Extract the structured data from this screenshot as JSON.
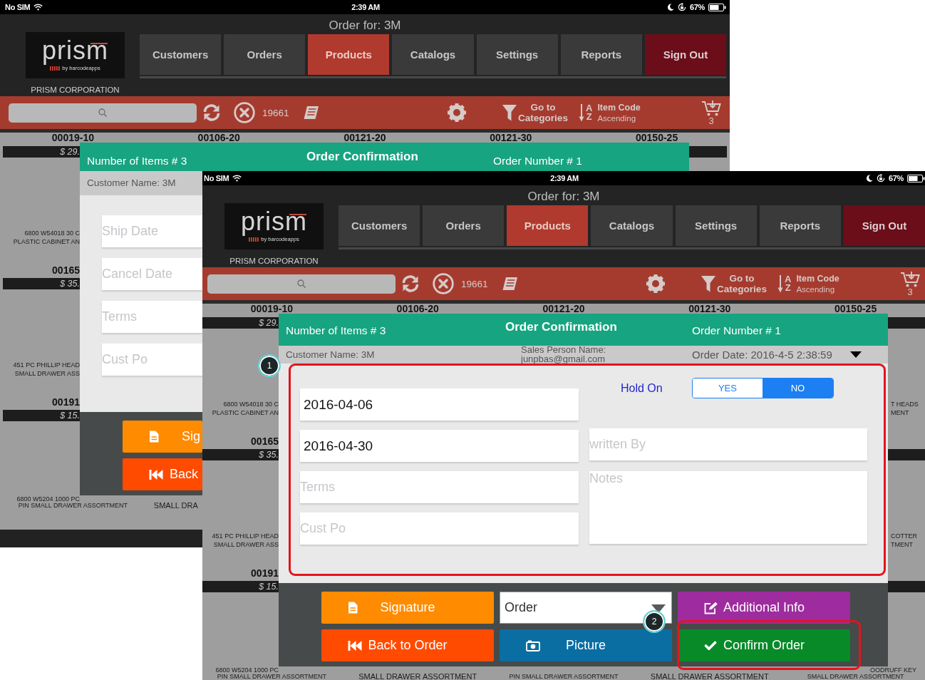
{
  "screenshots": [
    {
      "status_bar": {
        "carrier": "No SIM",
        "time": "2:39 AM",
        "battery": "67%"
      },
      "header": {
        "title": "Order for: 3M",
        "logo": {
          "wordmark": "prism",
          "tagline": "by barcodeapps"
        },
        "company": "PRISM CORPORATION"
      },
      "nav_tabs": [
        {
          "label": "Customers",
          "kind": "tab",
          "selected": false
        },
        {
          "label": "Orders",
          "kind": "tab",
          "selected": false
        },
        {
          "label": "Products",
          "kind": "tab",
          "selected": true
        },
        {
          "label": "Catalogs",
          "kind": "tab",
          "selected": false
        },
        {
          "label": "Settings",
          "kind": "tab",
          "selected": false
        },
        {
          "label": "Reports",
          "kind": "tab",
          "selected": false
        },
        {
          "label": "Sign Out",
          "kind": "action",
          "selected": false
        }
      ],
      "toolbar": {
        "count": "19661",
        "categories_button": "Go to Categories",
        "sort": {
          "letters": [
            "A",
            "Z"
          ],
          "field": "Item Code",
          "direction": "Ascending"
        },
        "cart_count": "3"
      },
      "product_grid": {
        "codes": [
          "00019-10",
          "00106-20",
          "00121-20",
          "00121-30",
          "00150-25"
        ],
        "left_edge": [
          {
            "price": "$ 29."
          },
          {
            "description": [
              "6800 W54018 30 C",
              "PLASTIC CABINET AN"
            ],
            "code": "00165",
            "price": "$ 35."
          },
          {
            "description": [
              "451 PC PHILLIP HEAD",
              "SMALL DRAWER ASS"
            ],
            "code": "00191",
            "price": "$ 15."
          }
        ],
        "bottom_row": [
          {
            "description": [
              "6800 W5204 1000 PC",
              "PIN SMALL DRAWER ASSORTMENT"
            ]
          },
          {
            "description": [
              "SMALL DRA"
            ]
          }
        ]
      },
      "dialog": {
        "items_count": "Number of Items # 3",
        "title": "Order Confirmation",
        "order_number": "Order Number # 1",
        "customer": "Customer Name: 3M",
        "fields": [
          {
            "placeholder": "Ship Date"
          },
          {
            "placeholder": "Cancel Date"
          },
          {
            "placeholder": "Terms"
          },
          {
            "placeholder": "Cust Po"
          }
        ],
        "actions": [
          {
            "kind": "signature",
            "label": "Sig"
          },
          {
            "kind": "back",
            "label": "Back"
          }
        ]
      }
    },
    {
      "status_bar": {
        "carrier": "No SIM",
        "time": "2:39 AM",
        "battery": "67%"
      },
      "header": {
        "title": "Order for: 3M",
        "logo": {
          "wordmark": "prism",
          "tagline": "by barcodeapps"
        },
        "company": "PRISM CORPORATION"
      },
      "nav_tabs": [
        {
          "label": "Customers",
          "kind": "tab",
          "selected": false
        },
        {
          "label": "Orders",
          "kind": "tab",
          "selected": false
        },
        {
          "label": "Products",
          "kind": "tab",
          "selected": true
        },
        {
          "label": "Catalogs",
          "kind": "tab",
          "selected": false
        },
        {
          "label": "Settings",
          "kind": "tab",
          "selected": false
        },
        {
          "label": "Reports",
          "kind": "tab",
          "selected": false
        },
        {
          "label": "Sign Out",
          "kind": "action",
          "selected": false
        }
      ],
      "toolbar": {
        "count": "19661",
        "categories_button": "Go to Categories",
        "sort": {
          "letters": [
            "A",
            "Z"
          ],
          "field": "Item Code",
          "direction": "Ascending"
        },
        "cart_count": "3"
      },
      "product_grid": {
        "codes": [
          "00019-10",
          "00106-20",
          "00121-20",
          "00121-30",
          "00150-25"
        ],
        "left_edge": [
          {
            "price": "$ 29."
          },
          {
            "description": [
              "6800 W54018 30 C",
              "PLASTIC CABINET AN"
            ],
            "code": "00165",
            "price": "$ 35."
          },
          {
            "description": [
              "451 PC PHILLIP HEAD",
              "SMALL DRAWER ASS"
            ],
            "code": "00191",
            "price": "$ 15."
          }
        ],
        "right_edge": [
          {
            "description": [
              "T HEADS",
              "MENT"
            ]
          },
          {
            "description": [
              "COTTER",
              "TMENT"
            ]
          }
        ],
        "bottom_row": [
          {
            "description": [
              "6800 W5204 1000 PC",
              "PIN SMALL DRAWER ASSORTMENT"
            ]
          },
          {
            "description": [
              "SMALL DRAWER ASSORTMENT"
            ]
          },
          {
            "description": [
              "PIN SMALL DRAWER ASSORTMENT"
            ]
          },
          {
            "description": [
              "SMALL DRAWER ASSORTMENT"
            ]
          },
          {
            "description": [
              "OODRUFF KEY",
              "SMALL DRAWER ASSORTMENT"
            ]
          }
        ]
      },
      "dialog": {
        "items_count": "Number of Items # 3",
        "title": "Order Confirmation",
        "order_number": "Order Number # 1",
        "customer": "Customer Name: 3M",
        "sales_person": "Sales Person Name: junpbas@gmail.com",
        "order_date": "Order Date: 2016-4-5 2:38:59",
        "fields": [
          {
            "value": "2016-04-06"
          },
          {
            "value": "2016-04-30"
          },
          {
            "placeholder": "Terms"
          },
          {
            "placeholder": "Cust Po"
          }
        ],
        "hold_on": {
          "label": "Hold On",
          "options": [
            {
              "label": "YES",
              "selected": false
            },
            {
              "label": "NO",
              "selected": true
            }
          ]
        },
        "side_fields": [
          {
            "kind": "line",
            "placeholder": "written By"
          },
          {
            "kind": "notes",
            "placeholder": "Notes"
          }
        ],
        "actions": [
          {
            "kind": "signature",
            "label": "Signature"
          },
          {
            "kind": "dropdown",
            "value": "Order"
          },
          {
            "kind": "info",
            "label": "Additional Info"
          },
          {
            "kind": "back",
            "label": "Back to Order"
          },
          {
            "kind": "picture",
            "label": "Picture"
          },
          {
            "kind": "confirm",
            "label": "Confirm Order"
          }
        ]
      },
      "annotations": [
        {
          "label": "1"
        },
        {
          "label": "2"
        }
      ]
    }
  ]
}
